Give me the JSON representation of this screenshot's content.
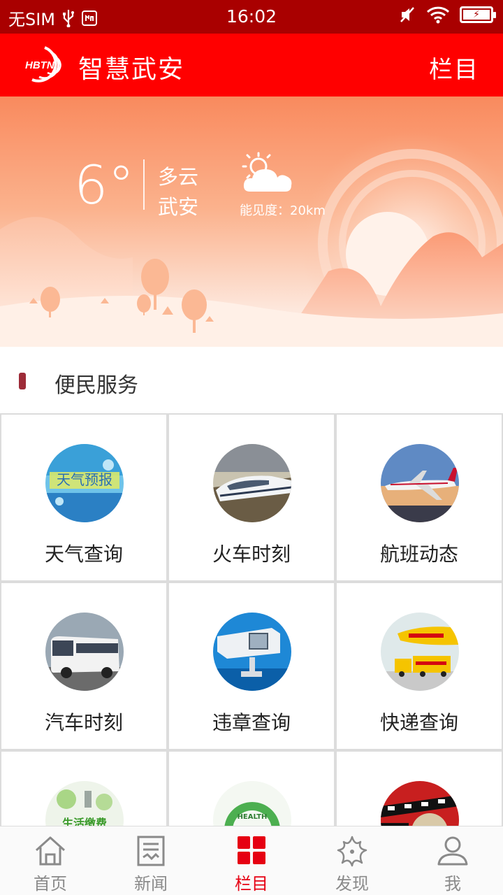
{
  "status_bar": {
    "carrier": "无SIM",
    "time": "16:02",
    "battery_icon": "battery-charging-icon"
  },
  "app_bar": {
    "logo_text": "HBTN",
    "title": "智慧武安",
    "menu_label": "栏目"
  },
  "weather": {
    "temperature": "6°",
    "condition": "多云",
    "city": "武安",
    "visibility": "能见度：20km",
    "icon": "partly-cloudy-icon"
  },
  "section": {
    "title": "便民服务"
  },
  "services": [
    {
      "label": "天气查询",
      "icon": "weather-forecast-image",
      "image_text": "天气预报"
    },
    {
      "label": "火车时刻",
      "icon": "train-image"
    },
    {
      "label": "航班动态",
      "icon": "airplane-image"
    },
    {
      "label": "汽车时刻",
      "icon": "bus-image"
    },
    {
      "label": "违章查询",
      "icon": "traffic-camera-image"
    },
    {
      "label": "快递查询",
      "icon": "delivery-truck-image"
    },
    {
      "label": "",
      "icon": "utility-payment-image",
      "image_text": "生活缴费"
    },
    {
      "label": "",
      "icon": "health-image",
      "image_text": "HEALTH"
    },
    {
      "label": "",
      "icon": "movie-image"
    }
  ],
  "bottom_nav": [
    {
      "label": "首页",
      "icon": "home-icon"
    },
    {
      "label": "新闻",
      "icon": "news-icon"
    },
    {
      "label": "栏目",
      "icon": "grid-icon",
      "active": true
    },
    {
      "label": "发现",
      "icon": "starfish-icon"
    },
    {
      "label": "我",
      "icon": "user-icon"
    }
  ],
  "colors": {
    "status_bar": "#a90000",
    "app_bar": "#ff0000",
    "active_tab": "#e60012",
    "inactive_tab": "#8a8a8a",
    "section_marker": "#9d2b38"
  }
}
